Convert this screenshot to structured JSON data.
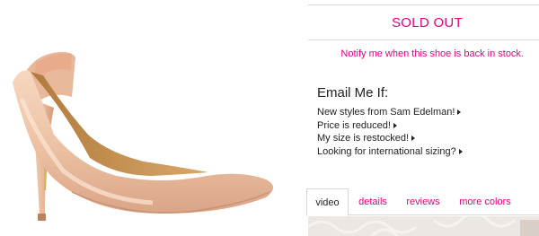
{
  "product": {
    "image_alt": "Nude patent pointed-toe pump"
  },
  "stock": {
    "status": "SOLD OUT",
    "notify_link": "Notify me when this shoe is back in stock."
  },
  "email_alerts": {
    "title": "Email Me If:",
    "items": [
      {
        "label": "New styles from Sam Edelman!"
      },
      {
        "label": "Price is reduced!"
      },
      {
        "label": "My size is restocked!"
      },
      {
        "label": "Looking for international sizing?"
      }
    ]
  },
  "tabs": [
    {
      "label": "video",
      "active": true
    },
    {
      "label": "details",
      "active": false
    },
    {
      "label": "reviews",
      "active": false
    },
    {
      "label": "more colors",
      "active": false
    }
  ],
  "colors": {
    "accent": "#e5007e",
    "text": "#222222",
    "border": "#d8d8d8",
    "shoe_nude": "#f0c9ae"
  }
}
